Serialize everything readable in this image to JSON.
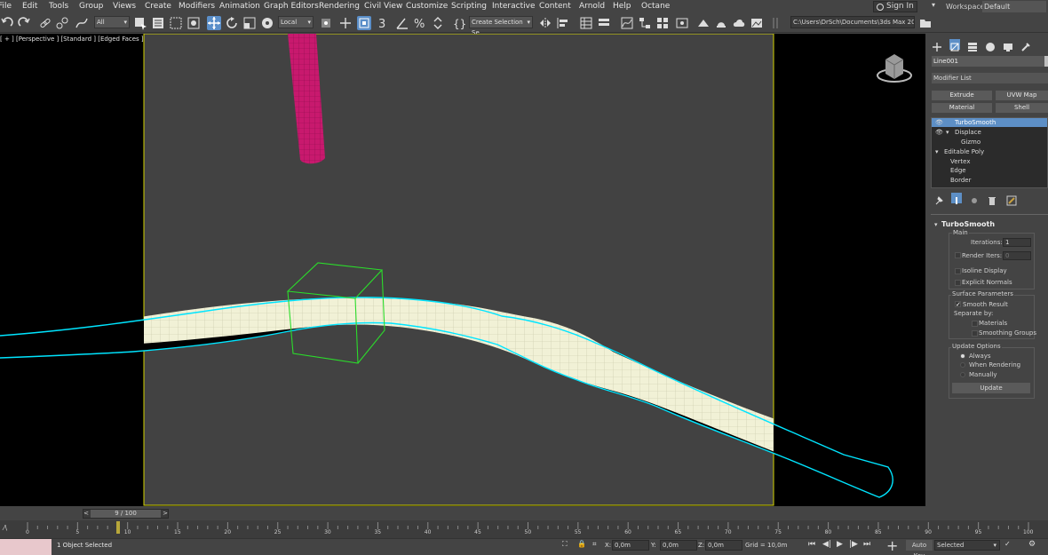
{
  "menu": [
    "File",
    "Edit",
    "Tools",
    "Group",
    "Views",
    "Create",
    "Modifiers",
    "Animation",
    "Graph Editors",
    "Rendering",
    "Civil View",
    "Customize",
    "Scripting",
    "Interactive",
    "Content",
    "Arnold",
    "Help",
    "Octane"
  ],
  "account": {
    "sign_in": "Sign In",
    "workspaces_label": "Workspaces:",
    "workspace": "Default"
  },
  "toolbar": {
    "selection_filter": "All",
    "ref_coord": "Local",
    "named_selection": "Create Selection Se",
    "project_path": "C:\\Users\\DrSch\\Documents\\3ds Max 2020"
  },
  "viewport": {
    "label": "[ + ] [Perspective ] [Standard ] [Edged Faces ]"
  },
  "command_panel": {
    "object_name": "Line001",
    "modifier_list": "Modifier List",
    "buttons": [
      "Extrude",
      "UVW Map",
      "Material",
      "Shell"
    ],
    "stack": [
      {
        "label": "TurboSmooth",
        "selected": true
      },
      {
        "label": "Displace"
      },
      {
        "label": "Gizmo"
      },
      {
        "label": "Editable Poly"
      },
      {
        "label": "Vertex"
      },
      {
        "label": "Edge"
      },
      {
        "label": "Border"
      }
    ],
    "rollout": {
      "title": "TurboSmooth",
      "main": "Main",
      "iterations_label": "Iterations:",
      "iterations": "1",
      "render_iters_label": "Render Iters:",
      "render_iters": "0",
      "isoline_display": "Isoline Display",
      "explicit_normals": "Explicit Normals",
      "surface_parameters": "Surface Parameters",
      "smooth_result": "Smooth Result",
      "smooth_result_checked": true,
      "separate_by": "Separate by:",
      "materials": "Materials",
      "smoothing_groups": "Smoothing Groups",
      "update_options": "Update Options",
      "always": "Always",
      "when_rendering": "When Rendering",
      "manually": "Manually",
      "update_button": "Update"
    }
  },
  "timeline": {
    "frame": "9 / 100",
    "ticks": [
      "0",
      "5",
      "10",
      "15",
      "20",
      "25",
      "30",
      "35",
      "40",
      "45",
      "50",
      "55",
      "60",
      "65",
      "70",
      "75",
      "80",
      "85",
      "90",
      "95",
      "100"
    ]
  },
  "status": {
    "selection": "1 Object Selected",
    "x_label": "X:",
    "x": "0,0m",
    "y_label": "Y:",
    "y": "0,0m",
    "z_label": "Z:",
    "z": "0,0m",
    "grid": "Grid = 10,0m",
    "auto_key": "Auto Key",
    "key_filter": "Selected"
  },
  "colors": {
    "selection_highlight": "#5d8fc6",
    "spline": "#00e5ff",
    "gizmo": "#2bdc2b",
    "safe_frame": "#d4d400",
    "background_object": "#c8196e",
    "mesh": "#f0f0d4"
  }
}
